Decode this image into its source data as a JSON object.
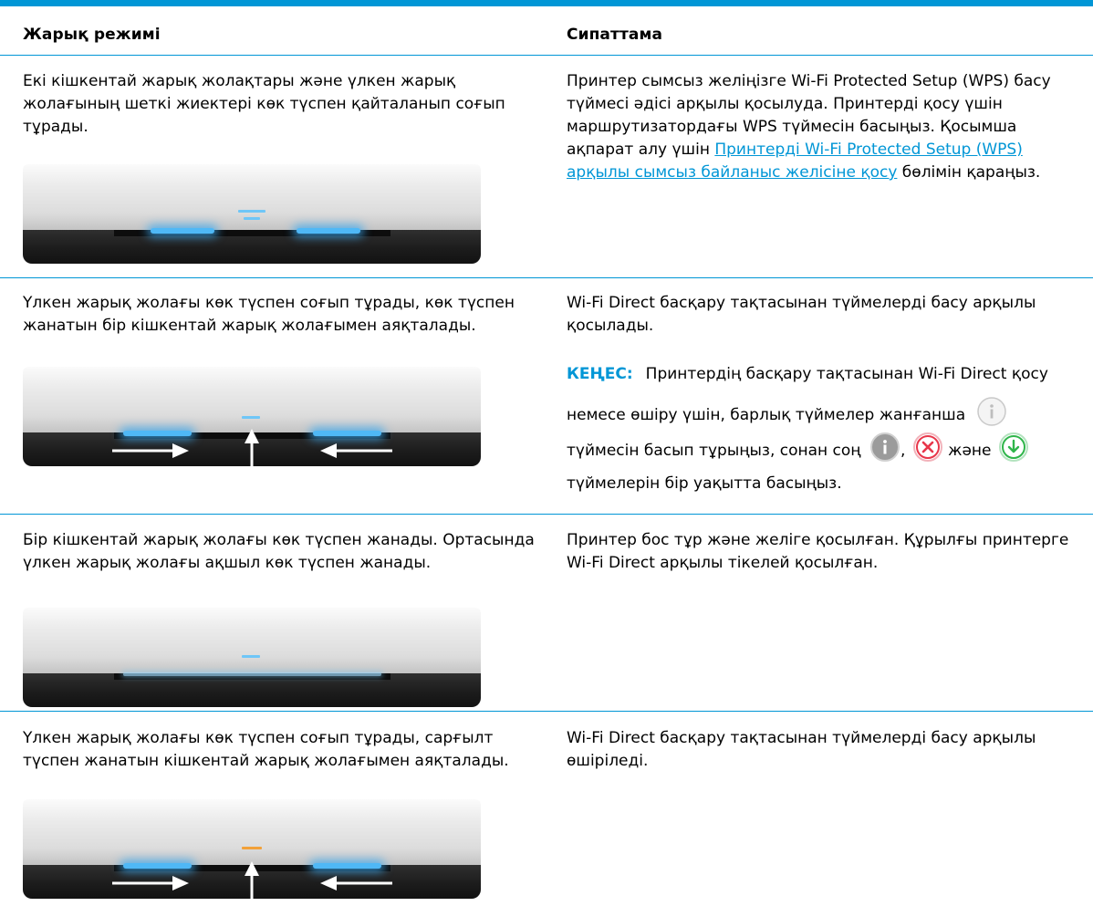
{
  "table": {
    "headers": {
      "mode": "Жарық режимі",
      "description": "Сипаттама"
    },
    "rows": [
      {
        "mode": "Екі кішкентай жарық жолақтары және үлкен жарық жолағының шеткі жиектері көк түспен қайталанып соғып тұрады.",
        "desc_before": "Принтер сымсыз желіңізге Wi-Fi Protected Setup (WPS) басу түймесі әдісі арқылы қосылуда. Принтерді қосу үшін маршрутизатордағы WPS түймесін басыңыз. Қосымша ақпарат алу үшін ",
        "desc_link": "Принтерді Wi-Fi Protected Setup (WPS) арқылы сымсыз байланыс желісіне қосу",
        "desc_after": " бөлімін қараңыз."
      },
      {
        "mode": "Үлкен жарық жолағы көк түспен соғып тұрады, көк түспен жанатын бір кішкентай жарық жолағымен аяқталады.",
        "desc": "Wi-Fi Direct басқару тақтасынан түймелерді басу арқылы қосылады.",
        "tip_label": "КЕҢЕС:",
        "tip_line1": "Принтердің басқару тақтасынан Wi-Fi Direct қосу",
        "tip_line2": "немесе өшіру үшін, барлық түймелер жанғанша",
        "tip_line3_a": "түймесін басып тұрыңыз, сонан соң",
        "tip_comma": ",",
        "tip_and": "және",
        "tip_line4": "түймелерін бір уақытта басыңыз."
      },
      {
        "mode": "Бір кішкентай жарық жолағы көк түспен жанады. Ортасында үлкен жарық жолағы ақшыл көк түспен жанады.",
        "desc": "Принтер бос тұр және желіге қосылған. Құрылғы принтерге Wi-Fi Direct арқылы тікелей қосылған."
      },
      {
        "mode": "Үлкен жарық жолағы көк түспен соғып тұрады, сарғылт түспен жанатын кішкентай жарық жолағымен аяқталады.",
        "desc": "Wi-Fi Direct басқару тақтасынан түймелерді басу арқылы өшіріледі."
      }
    ]
  },
  "icons": [
    "info-button-icon",
    "cancel-button-icon",
    "resume-button-icon",
    "arrow-right-icon",
    "arrow-up-icon",
    "arrow-left-icon"
  ],
  "colors": {
    "accent": "#0096d6",
    "light_blue": "#4fb8f6",
    "amber": "#f2a13a",
    "cancel": "#e8364a",
    "resume": "#2fb54a"
  }
}
